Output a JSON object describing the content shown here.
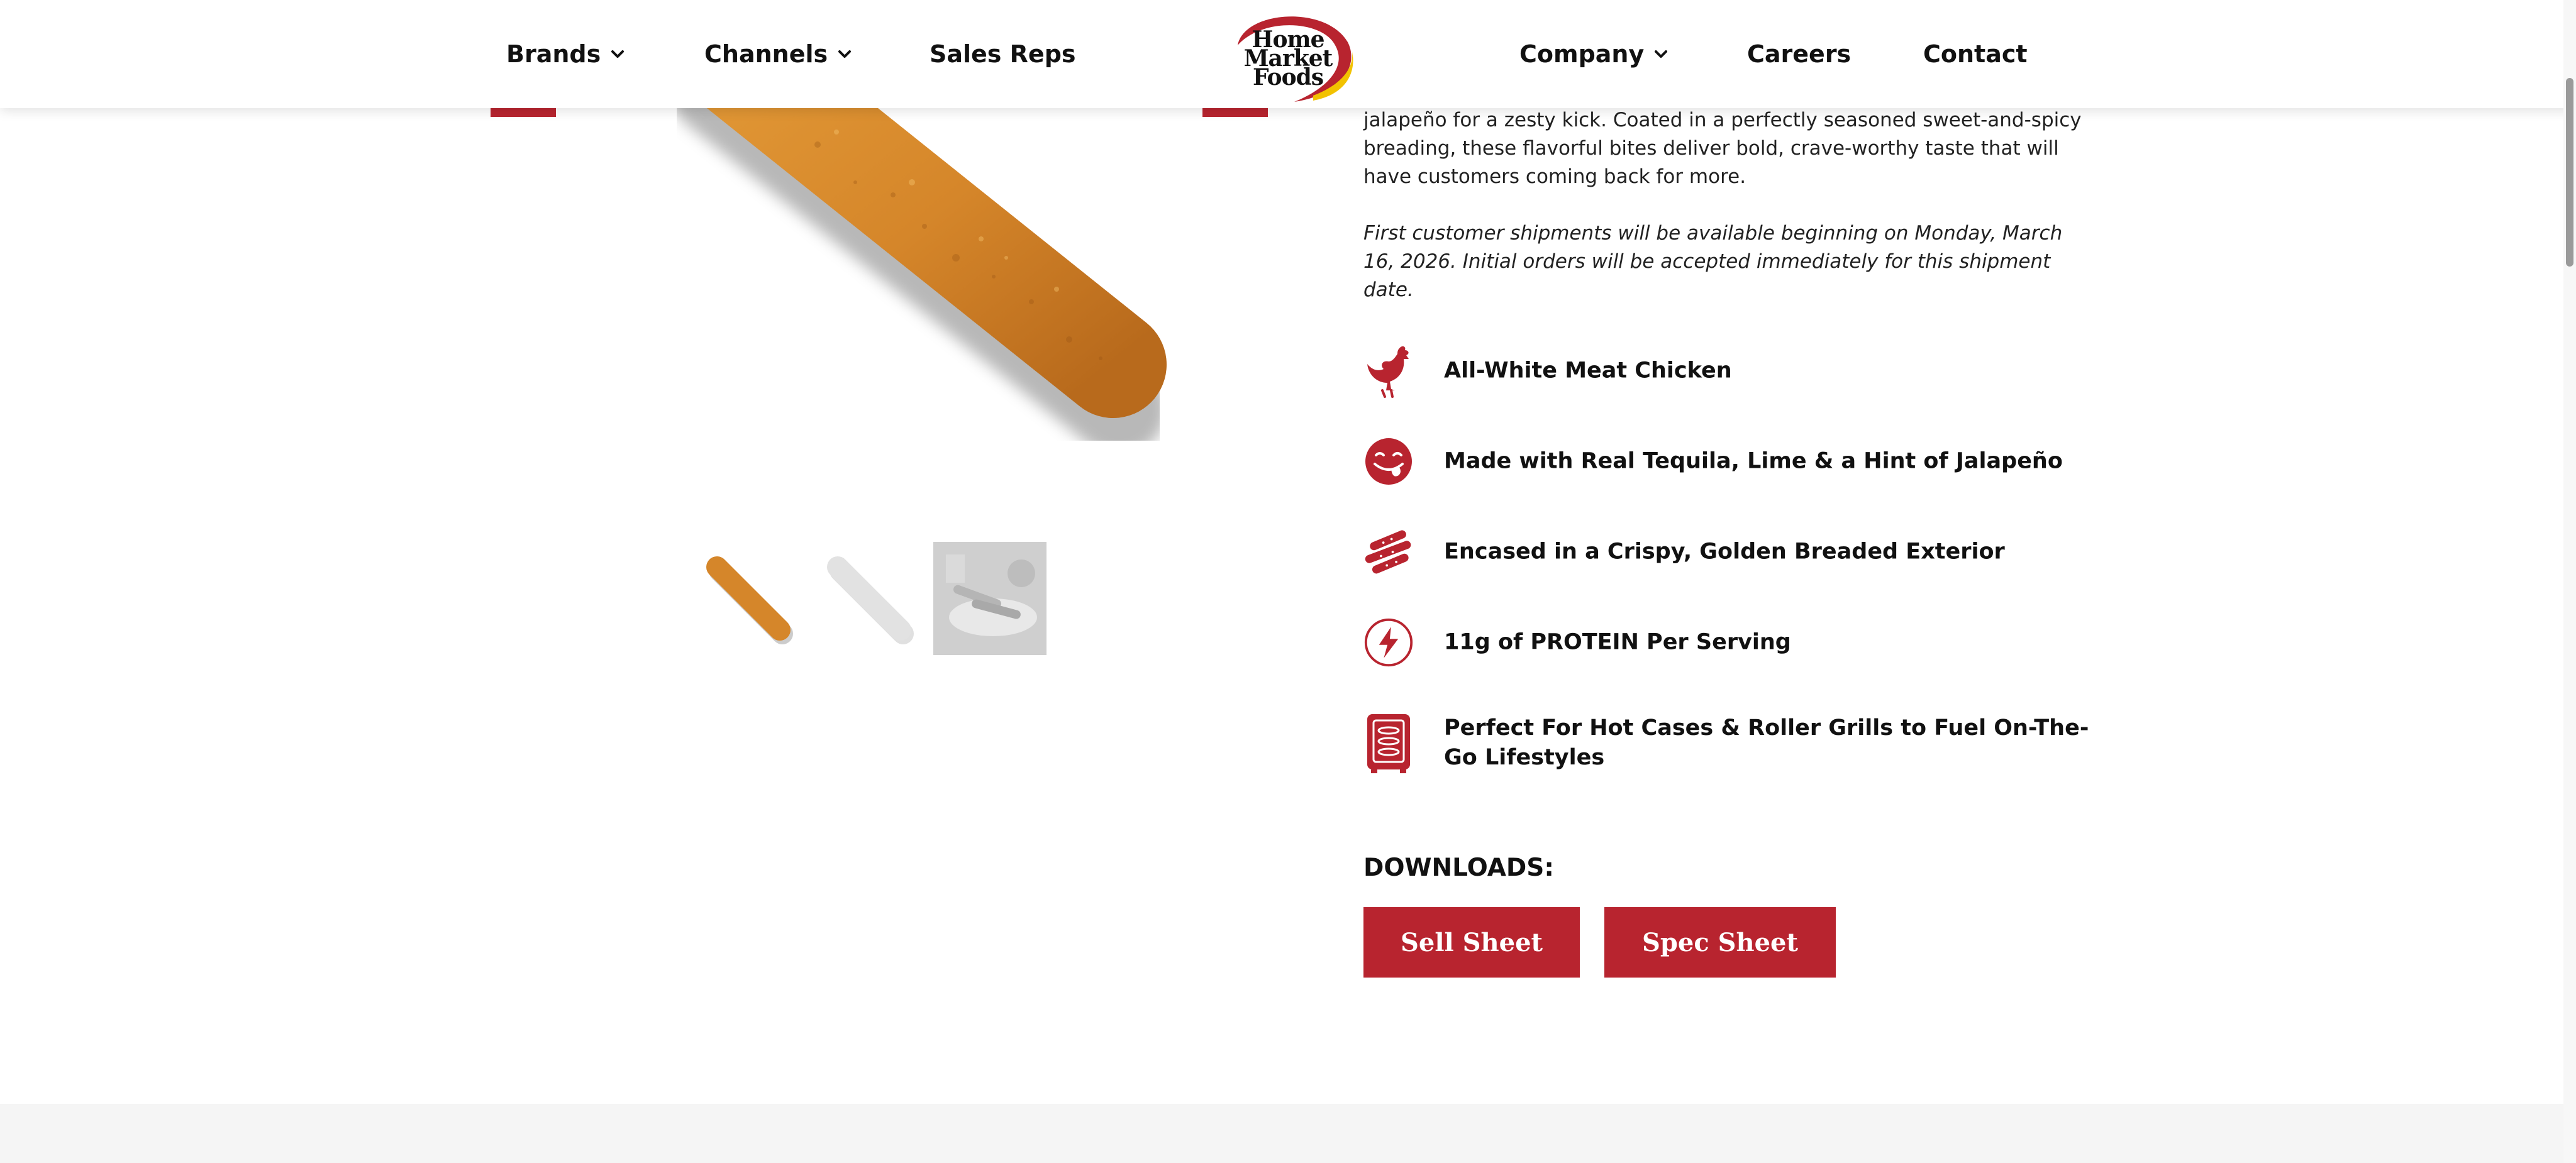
{
  "nav": {
    "brands": "Brands",
    "channels": "Channels",
    "sales_reps": "Sales Reps",
    "company": "Company",
    "careers": "Careers",
    "contact": "Contact"
  },
  "logo": {
    "line1": "Home",
    "line2": "Market",
    "line3": "Foods"
  },
  "product": {
    "description": "jalapeño for a zesty kick. Coated in a perfectly seasoned sweet-and-spicy breading, these flavorful bites deliver bold, crave-worthy taste that will have customers coming back for more.",
    "shipment_note": "First customer shipments will be available beginning on Monday, March 16, 2026. Initial orders will be accepted immediately for this shipment date."
  },
  "features": [
    {
      "icon": "chicken-icon",
      "text": "All-White Meat Chicken"
    },
    {
      "icon": "tongue-smiley-icon",
      "text": "Made with Real Tequila, Lime & a Hint of Jalapeño"
    },
    {
      "icon": "breaded-sticks-icon",
      "text": "Encased in a Crispy, Golden Breaded Exterior"
    },
    {
      "icon": "lightning-bolt-icon",
      "text": "11g of PROTEIN Per Serving"
    },
    {
      "icon": "roller-grill-icon",
      "text": "Perfect For Hot Cases & Roller Grills to Fuel On-The-Go Lifestyles"
    }
  ],
  "downloads": {
    "label": "DOWNLOADS:",
    "sell_sheet": "Sell Sheet",
    "spec_sheet": "Spec Sheet"
  },
  "colors": {
    "brand_red": "#b8242f",
    "product_orange": "#d98a2b",
    "footer_gray": "#f5f5f5"
  }
}
